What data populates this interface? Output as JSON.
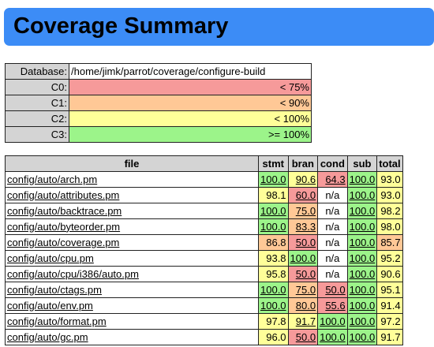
{
  "title": "Coverage Summary",
  "colors": {
    "banner": "#3c8cf6",
    "c0": "#f69a9a",
    "c1": "#ffc896",
    "c2": "#ffff99",
    "c3": "#9cf48a",
    "header_bg": "#d4d4d4"
  },
  "legend": {
    "database_label": "Database:",
    "database_value": "/home/jimk/parrot/coverage/configure-build",
    "rows": [
      {
        "label": "C0:",
        "value": "< 75%",
        "class": "c0"
      },
      {
        "label": "C1:",
        "value": "< 90%",
        "class": "c1"
      },
      {
        "label": "C2:",
        "value": "< 100%",
        "class": "c2"
      },
      {
        "label": "C3:",
        "value": ">= 100%",
        "class": "c3"
      }
    ]
  },
  "table": {
    "headers": [
      "file",
      "stmt",
      "bran",
      "cond",
      "sub",
      "total"
    ],
    "rows": [
      {
        "file": "config/auto/arch.pm",
        "stmt": "100.0",
        "bran": "90.6",
        "cond": "64.3",
        "sub": "100.0",
        "total": "93.0"
      },
      {
        "file": "config/auto/attributes.pm",
        "stmt": "98.1",
        "bran": "60.0",
        "cond": "n/a",
        "sub": "100.0",
        "total": "93.0"
      },
      {
        "file": "config/auto/backtrace.pm",
        "stmt": "100.0",
        "bran": "75.0",
        "cond": "n/a",
        "sub": "100.0",
        "total": "98.2"
      },
      {
        "file": "config/auto/byteorder.pm",
        "stmt": "100.0",
        "bran": "83.3",
        "cond": "n/a",
        "sub": "100.0",
        "total": "98.0"
      },
      {
        "file": "config/auto/coverage.pm",
        "stmt": "86.8",
        "bran": "50.0",
        "cond": "n/a",
        "sub": "100.0",
        "total": "85.7"
      },
      {
        "file": "config/auto/cpu.pm",
        "stmt": "93.8",
        "bran": "100.0",
        "cond": "n/a",
        "sub": "100.0",
        "total": "95.2"
      },
      {
        "file": "config/auto/cpu/i386/auto.pm",
        "stmt": "95.8",
        "bran": "50.0",
        "cond": "n/a",
        "sub": "100.0",
        "total": "90.6"
      },
      {
        "file": "config/auto/ctags.pm",
        "stmt": "100.0",
        "bran": "75.0",
        "cond": "50.0",
        "sub": "100.0",
        "total": "95.1"
      },
      {
        "file": "config/auto/env.pm",
        "stmt": "100.0",
        "bran": "80.0",
        "cond": "55.6",
        "sub": "100.0",
        "total": "91.4"
      },
      {
        "file": "config/auto/format.pm",
        "stmt": "97.8",
        "bran": "91.7",
        "cond": "100.0",
        "sub": "100.0",
        "total": "97.2"
      },
      {
        "file": "config/auto/gc.pm",
        "stmt": "96.0",
        "bran": "50.0",
        "cond": "100.0",
        "sub": "100.0",
        "total": "91.7"
      }
    ]
  }
}
